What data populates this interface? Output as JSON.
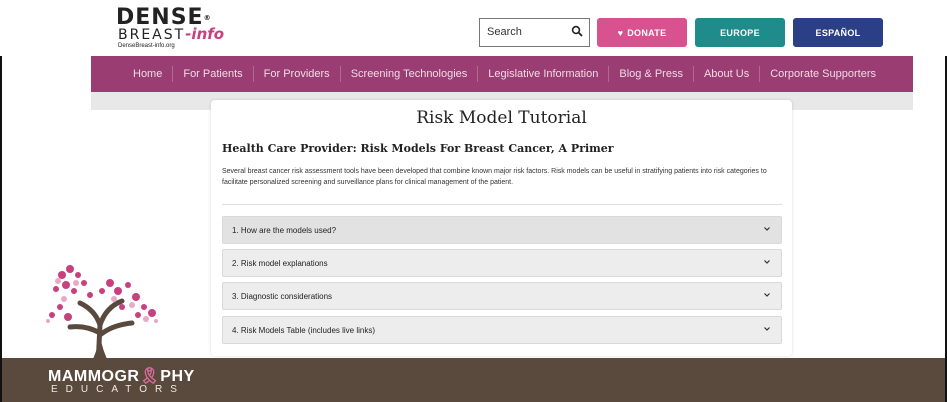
{
  "header": {
    "logo": {
      "line1": "DENSE",
      "reg": "®",
      "line2_a": "BREAST",
      "line2_b": "-info",
      "url": "DenseBreast-info.org"
    },
    "search": {
      "placeholder": "Search",
      "icon": "search-icon"
    },
    "donate_label": "DONATE",
    "europe_label": "EUROPE",
    "espanol_label": "ESPAÑOL"
  },
  "nav": {
    "items": [
      {
        "label": "Home"
      },
      {
        "label": "For Patients"
      },
      {
        "label": "For Providers"
      },
      {
        "label": "Screening Technologies"
      },
      {
        "label": "Legislative Information"
      },
      {
        "label": "Blog & Press"
      },
      {
        "label": "About Us"
      },
      {
        "label": "Corporate Supporters"
      }
    ]
  },
  "content": {
    "title": "Risk Model Tutorial",
    "subtitle": "Health Care Provider: Risk Models For Breast Cancer, A Primer",
    "description": "Several breast cancer risk assessment tools have been developed that combine known major risk factors. Risk models can be useful in stratifying patients into risk categories to facilitate personalized screening and surveillance plans for clinical management of the patient.",
    "accordion": [
      {
        "label": "1. How are the models used?"
      },
      {
        "label": "2. Risk model explanations"
      },
      {
        "label": "3. Diagnostic considerations"
      },
      {
        "label": "4. Risk Models Table (includes live links)"
      }
    ]
  },
  "footer": {
    "brand_a": "MAMMOGR",
    "brand_ribbon": "🎗",
    "brand_b": "PHY",
    "brand_sub": "EDUCATORS"
  },
  "colors": {
    "nav": "#9a3d72",
    "donate": "#d8528f",
    "europe": "#1f8b8b",
    "espanol": "#2a3f86",
    "footer": "#5a4a3e"
  }
}
